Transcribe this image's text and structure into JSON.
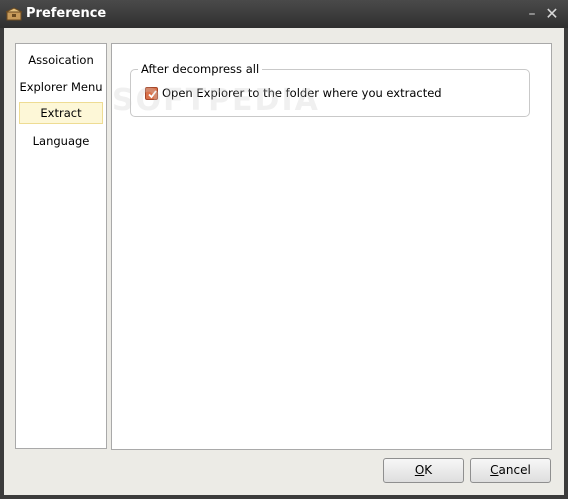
{
  "window": {
    "title": "Preference",
    "minimize_glyph": "–",
    "close_glyph": "✕"
  },
  "sidebar": {
    "items": [
      {
        "label": "Assoication",
        "selected": false
      },
      {
        "label": "Explorer Menu",
        "selected": false
      },
      {
        "label": "Extract",
        "selected": true
      },
      {
        "label": "Language",
        "selected": false
      }
    ]
  },
  "extract_panel": {
    "group_title": "After decompress all",
    "open_explorer_label": "Open Explorer to the folder where you extracted",
    "open_explorer_checked": true
  },
  "watermark": "SOFTPEDIA",
  "buttons": {
    "ok_label": "OK",
    "cancel_label": "Cancel"
  },
  "colors": {
    "titlebar": "#3b3b3b",
    "dialog_bg": "#ecebe6",
    "selected_item_bg": "#fdf7d7",
    "checkbox_fill": "#d9714a"
  },
  "icons": {
    "app": "archive-icon",
    "check": "checkmark-icon"
  }
}
